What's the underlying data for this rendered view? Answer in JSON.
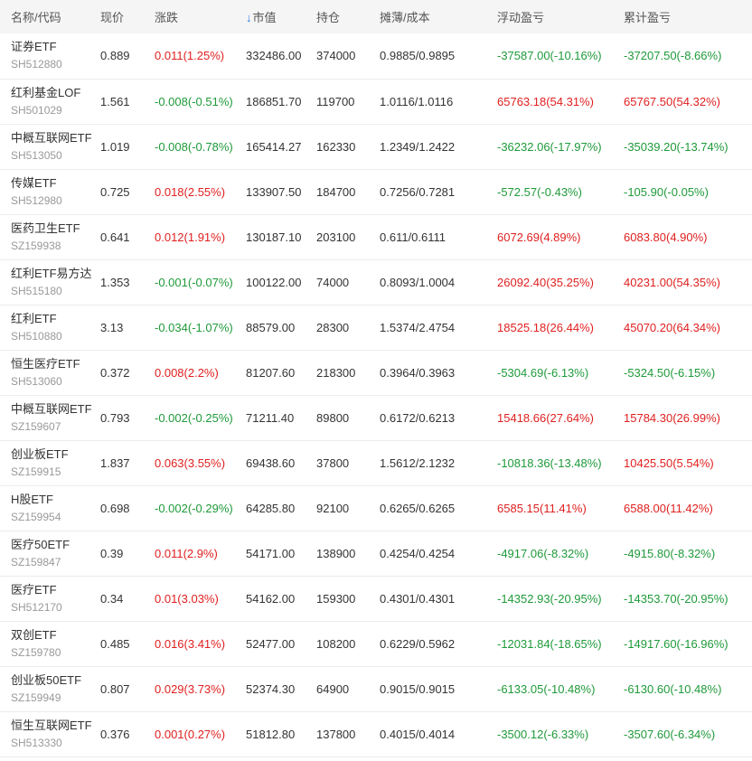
{
  "colors": {
    "up": "#e02020",
    "down": "#1f9a3a",
    "header_bg": "#f5f5f5",
    "sort_arrow": "#2a7ae2"
  },
  "header": {
    "name_code": "名称/代码",
    "price": "现价",
    "change": "涨跌",
    "sort_arrow": "↓",
    "market_value": "市值",
    "position": "持仓",
    "cost": "摊薄/成本",
    "float_pl": "浮动盈亏",
    "cum_pl": "累计盈亏"
  },
  "rows": [
    {
      "name": "证券ETF",
      "code": "SH512880",
      "price": "0.889",
      "change": "0.011(1.25%)",
      "change_dir": "up",
      "market_value": "332486.00",
      "position": "374000",
      "cost": "0.9885/0.9895",
      "float_pl": "-37587.00(-10.16%)",
      "float_dir": "down",
      "cum_pl": "-37207.50(-8.66%)",
      "cum_dir": "down"
    },
    {
      "name": "红利基金LOF",
      "code": "SH501029",
      "price": "1.561",
      "change": "-0.008(-0.51%)",
      "change_dir": "down",
      "market_value": "186851.70",
      "position": "119700",
      "cost": "1.0116/1.0116",
      "float_pl": "65763.18(54.31%)",
      "float_dir": "up",
      "cum_pl": "65767.50(54.32%)",
      "cum_dir": "up"
    },
    {
      "name": "中概互联网ETF",
      "code": "SH513050",
      "price": "1.019",
      "change": "-0.008(-0.78%)",
      "change_dir": "down",
      "market_value": "165414.27",
      "position": "162330",
      "cost": "1.2349/1.2422",
      "float_pl": "-36232.06(-17.97%)",
      "float_dir": "down",
      "cum_pl": "-35039.20(-13.74%)",
      "cum_dir": "down"
    },
    {
      "name": "传媒ETF",
      "code": "SH512980",
      "price": "0.725",
      "change": "0.018(2.55%)",
      "change_dir": "up",
      "market_value": "133907.50",
      "position": "184700",
      "cost": "0.7256/0.7281",
      "float_pl": "-572.57(-0.43%)",
      "float_dir": "down",
      "cum_pl": "-105.90(-0.05%)",
      "cum_dir": "down"
    },
    {
      "name": "医药卫生ETF",
      "code": "SZ159938",
      "price": "0.641",
      "change": "0.012(1.91%)",
      "change_dir": "up",
      "market_value": "130187.10",
      "position": "203100",
      "cost": "0.611/0.6111",
      "float_pl": "6072.69(4.89%)",
      "float_dir": "up",
      "cum_pl": "6083.80(4.90%)",
      "cum_dir": "up"
    },
    {
      "name": "红利ETF易方达",
      "code": "SH515180",
      "price": "1.353",
      "change": "-0.001(-0.07%)",
      "change_dir": "down",
      "market_value": "100122.00",
      "position": "74000",
      "cost": "0.8093/1.0004",
      "float_pl": "26092.40(35.25%)",
      "float_dir": "up",
      "cum_pl": "40231.00(54.35%)",
      "cum_dir": "up"
    },
    {
      "name": "红利ETF",
      "code": "SH510880",
      "price": "3.13",
      "change": "-0.034(-1.07%)",
      "change_dir": "down",
      "market_value": "88579.00",
      "position": "28300",
      "cost": "1.5374/2.4754",
      "float_pl": "18525.18(26.44%)",
      "float_dir": "up",
      "cum_pl": "45070.20(64.34%)",
      "cum_dir": "up"
    },
    {
      "name": "恒生医疗ETF",
      "code": "SH513060",
      "price": "0.372",
      "change": "0.008(2.2%)",
      "change_dir": "up",
      "market_value": "81207.60",
      "position": "218300",
      "cost": "0.3964/0.3963",
      "float_pl": "-5304.69(-6.13%)",
      "float_dir": "down",
      "cum_pl": "-5324.50(-6.15%)",
      "cum_dir": "down"
    },
    {
      "name": "中概互联网ETF",
      "code": "SZ159607",
      "price": "0.793",
      "change": "-0.002(-0.25%)",
      "change_dir": "down",
      "market_value": "71211.40",
      "position": "89800",
      "cost": "0.6172/0.6213",
      "float_pl": "15418.66(27.64%)",
      "float_dir": "up",
      "cum_pl": "15784.30(26.99%)",
      "cum_dir": "up"
    },
    {
      "name": "创业板ETF",
      "code": "SZ159915",
      "price": "1.837",
      "change": "0.063(3.55%)",
      "change_dir": "up",
      "market_value": "69438.60",
      "position": "37800",
      "cost": "1.5612/2.1232",
      "float_pl": "-10818.36(-13.48%)",
      "float_dir": "down",
      "cum_pl": "10425.50(5.54%)",
      "cum_dir": "up"
    },
    {
      "name": "H股ETF",
      "code": "SZ159954",
      "price": "0.698",
      "change": "-0.002(-0.29%)",
      "change_dir": "down",
      "market_value": "64285.80",
      "position": "92100",
      "cost": "0.6265/0.6265",
      "float_pl": "6585.15(11.41%)",
      "float_dir": "up",
      "cum_pl": "6588.00(11.42%)",
      "cum_dir": "up"
    },
    {
      "name": "医疗50ETF",
      "code": "SZ159847",
      "price": "0.39",
      "change": "0.011(2.9%)",
      "change_dir": "up",
      "market_value": "54171.00",
      "position": "138900",
      "cost": "0.4254/0.4254",
      "float_pl": "-4917.06(-8.32%)",
      "float_dir": "down",
      "cum_pl": "-4915.80(-8.32%)",
      "cum_dir": "down"
    },
    {
      "name": "医疗ETF",
      "code": "SH512170",
      "price": "0.34",
      "change": "0.01(3.03%)",
      "change_dir": "up",
      "market_value": "54162.00",
      "position": "159300",
      "cost": "0.4301/0.4301",
      "float_pl": "-14352.93(-20.95%)",
      "float_dir": "down",
      "cum_pl": "-14353.70(-20.95%)",
      "cum_dir": "down"
    },
    {
      "name": "双创ETF",
      "code": "SZ159780",
      "price": "0.485",
      "change": "0.016(3.41%)",
      "change_dir": "up",
      "market_value": "52477.00",
      "position": "108200",
      "cost": "0.6229/0.5962",
      "float_pl": "-12031.84(-18.65%)",
      "float_dir": "down",
      "cum_pl": "-14917.60(-16.96%)",
      "cum_dir": "down"
    },
    {
      "name": "创业板50ETF",
      "code": "SZ159949",
      "price": "0.807",
      "change": "0.029(3.73%)",
      "change_dir": "up",
      "market_value": "52374.30",
      "position": "64900",
      "cost": "0.9015/0.9015",
      "float_pl": "-6133.05(-10.48%)",
      "float_dir": "down",
      "cum_pl": "-6130.60(-10.48%)",
      "cum_dir": "down"
    },
    {
      "name": "恒生互联网ETF",
      "code": "SH513330",
      "price": "0.376",
      "change": "0.001(0.27%)",
      "change_dir": "up",
      "market_value": "51812.80",
      "position": "137800",
      "cost": "0.4015/0.4014",
      "float_pl": "-3500.12(-6.33%)",
      "float_dir": "down",
      "cum_pl": "-3507.60(-6.34%)",
      "cum_dir": "down"
    }
  ]
}
